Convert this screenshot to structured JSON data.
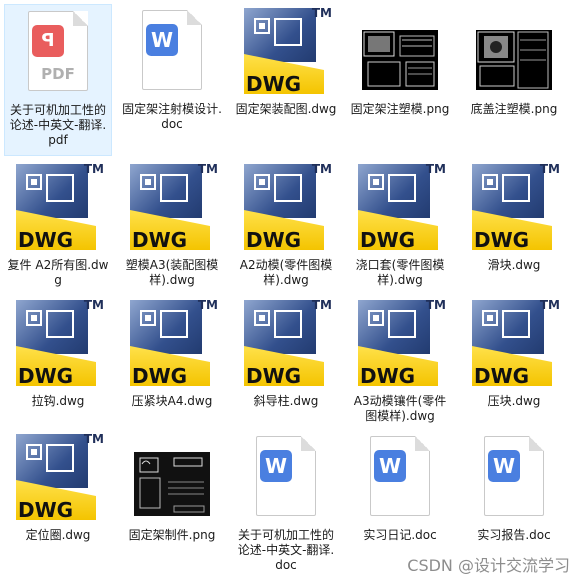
{
  "files": [
    {
      "label": "关于可机加工性的论述-中英文-翻译.pdf",
      "icon": "pdf-icon",
      "selected": true
    },
    {
      "label": "固定架注射模设计.doc",
      "icon": "word-icon"
    },
    {
      "label": "固定架装配图.dwg",
      "icon": "dwg-icon"
    },
    {
      "label": "固定架注塑模.png",
      "icon": "drawing-thumbnail"
    },
    {
      "label": "底盖注塑模.png",
      "icon": "drawing-thumbnail"
    },
    {
      "label": "复件 A2所有图.dwg",
      "icon": "dwg-icon"
    },
    {
      "label": "塑模A3(装配图模样).dwg",
      "icon": "dwg-icon"
    },
    {
      "label": "A2动模(零件图模样).dwg",
      "icon": "dwg-icon"
    },
    {
      "label": "浇口套(零件图模样).dwg",
      "icon": "dwg-icon"
    },
    {
      "label": "滑块.dwg",
      "icon": "dwg-icon"
    },
    {
      "label": "拉钩.dwg",
      "icon": "dwg-icon"
    },
    {
      "label": "压紧块A4.dwg",
      "icon": "dwg-icon"
    },
    {
      "label": "斜导柱.dwg",
      "icon": "dwg-icon"
    },
    {
      "label": "A3动模镶件(零件图模样).dwg",
      "icon": "dwg-icon"
    },
    {
      "label": "压块.dwg",
      "icon": "dwg-icon"
    },
    {
      "label": "定位圈.dwg",
      "icon": "dwg-icon"
    },
    {
      "label": "固定架制件.png",
      "icon": "drawing-thumbnail"
    },
    {
      "label": "关于可机加工性的论述-中英文-翻译.doc",
      "icon": "word-icon"
    },
    {
      "label": "实习日记.doc",
      "icon": "word-icon"
    },
    {
      "label": "实习报告.doc",
      "icon": "word-icon"
    }
  ],
  "icons": {
    "dwg_text": "DWG",
    "tm_text": "TM",
    "word_text": "W",
    "pdf_badge": "ꟼ",
    "pdf_text": "PDF"
  },
  "watermark": "CSDN @设计交流学习",
  "colors": {
    "selected_bg": "#e5f3ff",
    "word_blue": "#4a7fe0",
    "pdf_red": "#e95d5d",
    "dwg_yellow": "#f4c400",
    "dwg_blue": "#33508d"
  }
}
